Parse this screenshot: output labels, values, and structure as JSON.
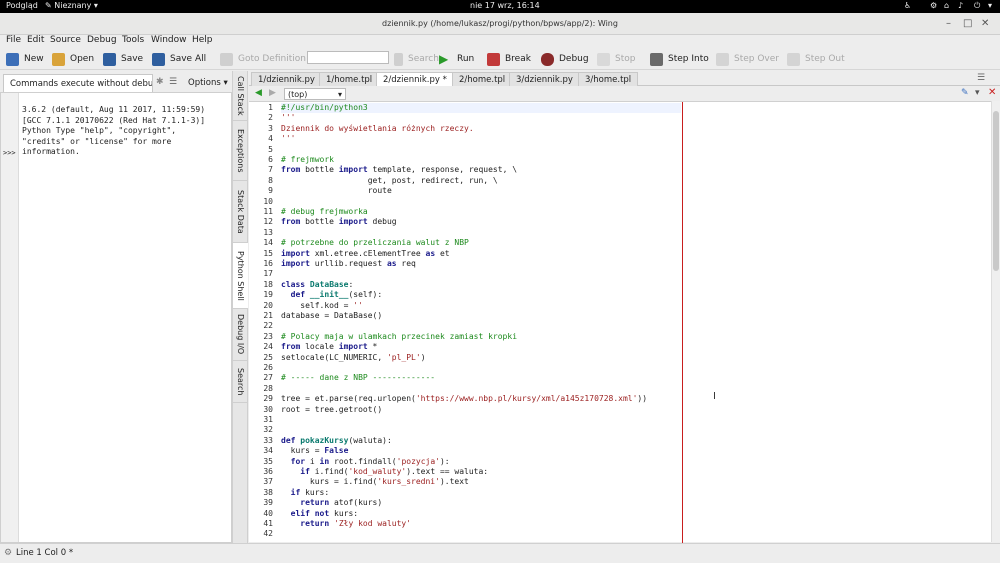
{
  "top_bar": {
    "activities": "Podgląd",
    "app": "Nieznany",
    "clock": "nie 17 wrz, 16:14"
  },
  "window": {
    "title": "dziennik.py (/home/lukasz/progi/python/bpws/app/2): Wing"
  },
  "menu": [
    "File",
    "Edit",
    "Source",
    "Debug",
    "Tools",
    "Window",
    "Help"
  ],
  "toolbar": {
    "new": "New",
    "open": "Open",
    "save": "Save",
    "save_all": "Save All",
    "goto": "Goto Definition",
    "search": "Search",
    "run": "Run",
    "break": "Break",
    "debug": "Debug",
    "stop": "Stop",
    "step_into": "Step Into",
    "step_over": "Step Over",
    "step_out": "Step Out"
  },
  "left_panel": {
    "tab": "Commands execute without debu",
    "options": "Options",
    "shell_lines": [
      "3.6.2 (default, Aug 11 2017, 11:59:59)",
      "[GCC 7.1.1 20170622 (Red Hat 7.1.1-3)]",
      "Python Type \"help\", \"copyright\",",
      "\"credits\" or \"license\" for more",
      "information."
    ],
    "prompt": ">>>"
  },
  "vertical_tabs": [
    "Call Stack",
    "Exceptions",
    "Stack Data",
    "Python Shell",
    "Debug I/O",
    "Search"
  ],
  "editor_tabs": [
    "1/dziennik.py",
    "1/home.tpl",
    "2/dziennik.py *",
    "2/home.tpl",
    "3/dziennik.py",
    "3/home.tpl"
  ],
  "scope": "(top)",
  "code": [
    [
      [
        "",
        "#!/usr/bin/python3",
        "cm"
      ]
    ],
    [
      [
        "",
        "'''",
        "st"
      ]
    ],
    [
      [
        "",
        "Dziennik do wyświetlania różnych rzeczy.",
        "st"
      ]
    ],
    [
      [
        "",
        "'''",
        "st"
      ]
    ],
    [],
    [
      [
        "",
        "# frejmwork",
        "cm"
      ]
    ],
    [
      [
        "",
        "from",
        "kw"
      ],
      [
        "",
        " bottle ",
        ""
      ],
      [
        "",
        "import",
        "kw"
      ],
      [
        "",
        " template, response, request, \\",
        ""
      ]
    ],
    [
      [
        "",
        "                  get, post, redirect, run, \\",
        ""
      ]
    ],
    [
      [
        "",
        "                  route",
        ""
      ]
    ],
    [],
    [
      [
        "",
        "# debug frejmworka",
        "cm"
      ]
    ],
    [
      [
        "",
        "from",
        "kw"
      ],
      [
        "",
        " bottle ",
        ""
      ],
      [
        "",
        "import",
        "kw"
      ],
      [
        "",
        " debug",
        ""
      ]
    ],
    [],
    [
      [
        "",
        "# potrzebne do przeliczania walut z NBP",
        "cm"
      ]
    ],
    [
      [
        "",
        "import",
        "kw"
      ],
      [
        "",
        " xml.etree.cElementTree ",
        ""
      ],
      [
        "",
        "as",
        "kw"
      ],
      [
        "",
        " et",
        ""
      ]
    ],
    [
      [
        "",
        "import",
        "kw"
      ],
      [
        "",
        " urllib.request ",
        ""
      ],
      [
        "",
        "as",
        "kw"
      ],
      [
        "",
        " req",
        ""
      ]
    ],
    [],
    [
      [
        "",
        "class",
        "kw"
      ],
      [
        "",
        " ",
        ""
      ],
      [
        "",
        "DataBase",
        "fn"
      ],
      [
        "",
        ":",
        ""
      ]
    ],
    [
      [
        "",
        "  ",
        ""
      ],
      [
        "",
        "def",
        "kw"
      ],
      [
        "",
        " ",
        ""
      ],
      [
        "",
        "__init__",
        "fn"
      ],
      [
        "",
        "(self):",
        ""
      ]
    ],
    [
      [
        "",
        "    self.kod = ",
        ""
      ],
      [
        "",
        "''",
        "st"
      ]
    ],
    [
      [
        "",
        "database = DataBase()",
        ""
      ]
    ],
    [],
    [
      [
        "",
        "# Polacy maja w ulamkach przecinek zamiast kropki",
        "cm"
      ]
    ],
    [
      [
        "",
        "from",
        "kw"
      ],
      [
        "",
        " locale ",
        ""
      ],
      [
        "",
        "import",
        "kw"
      ],
      [
        "",
        " *",
        ""
      ]
    ],
    [
      [
        "",
        "setlocale(LC_NUMERIC, ",
        ""
      ],
      [
        "",
        "'pl_PL'",
        "st"
      ],
      [
        "",
        ")",
        ""
      ]
    ],
    [],
    [
      [
        "",
        "# ----- dane z NBP -------------",
        "cm"
      ]
    ],
    [],
    [
      [
        "",
        "tree = et.parse(req.urlopen(",
        ""
      ],
      [
        "",
        "'https://www.nbp.pl/kursy/xml/a145z170728.xml'",
        "st"
      ],
      [
        "",
        "))",
        ""
      ]
    ],
    [
      [
        "",
        "root = tree.getroot()",
        ""
      ]
    ],
    [],
    [],
    [
      [
        "",
        "def",
        "kw"
      ],
      [
        "",
        " ",
        ""
      ],
      [
        "",
        "pokazKursy",
        "fn"
      ],
      [
        "",
        "(waluta):",
        ""
      ]
    ],
    [
      [
        "",
        "  kurs = ",
        ""
      ],
      [
        "",
        "False",
        "kw"
      ]
    ],
    [
      [
        "",
        "  ",
        ""
      ],
      [
        "",
        "for",
        "kw"
      ],
      [
        "",
        " i ",
        ""
      ],
      [
        "",
        "in",
        "kw"
      ],
      [
        "",
        " root.findall(",
        ""
      ],
      [
        "",
        "'pozycja'",
        "st"
      ],
      [
        "",
        "):",
        ""
      ]
    ],
    [
      [
        "",
        "    ",
        ""
      ],
      [
        "",
        "if",
        "kw"
      ],
      [
        "",
        " i.find(",
        ""
      ],
      [
        "",
        "'kod_waluty'",
        "st"
      ],
      [
        "",
        ").text == waluta:",
        ""
      ]
    ],
    [
      [
        "",
        "      kurs = i.find(",
        ""
      ],
      [
        "",
        "'kurs_sredni'",
        "st"
      ],
      [
        "",
        ").text",
        ""
      ]
    ],
    [
      [
        "",
        "  ",
        ""
      ],
      [
        "",
        "if",
        "kw"
      ],
      [
        "",
        " kurs:",
        ""
      ]
    ],
    [
      [
        "",
        "    ",
        ""
      ],
      [
        "",
        "return",
        "kw"
      ],
      [
        "",
        " atof(kurs)",
        ""
      ]
    ],
    [
      [
        "",
        "  ",
        ""
      ],
      [
        "",
        "elif",
        "kw"
      ],
      [
        "",
        " ",
        ""
      ],
      [
        "",
        "not",
        "kw"
      ],
      [
        "",
        " kurs:",
        ""
      ]
    ],
    [
      [
        "",
        "    ",
        ""
      ],
      [
        "",
        "return",
        "kw"
      ],
      [
        "",
        " ",
        ""
      ],
      [
        "",
        "'Zły kod waluty'",
        "st"
      ]
    ],
    []
  ],
  "status": {
    "position": "Line 1 Col 0 *"
  }
}
